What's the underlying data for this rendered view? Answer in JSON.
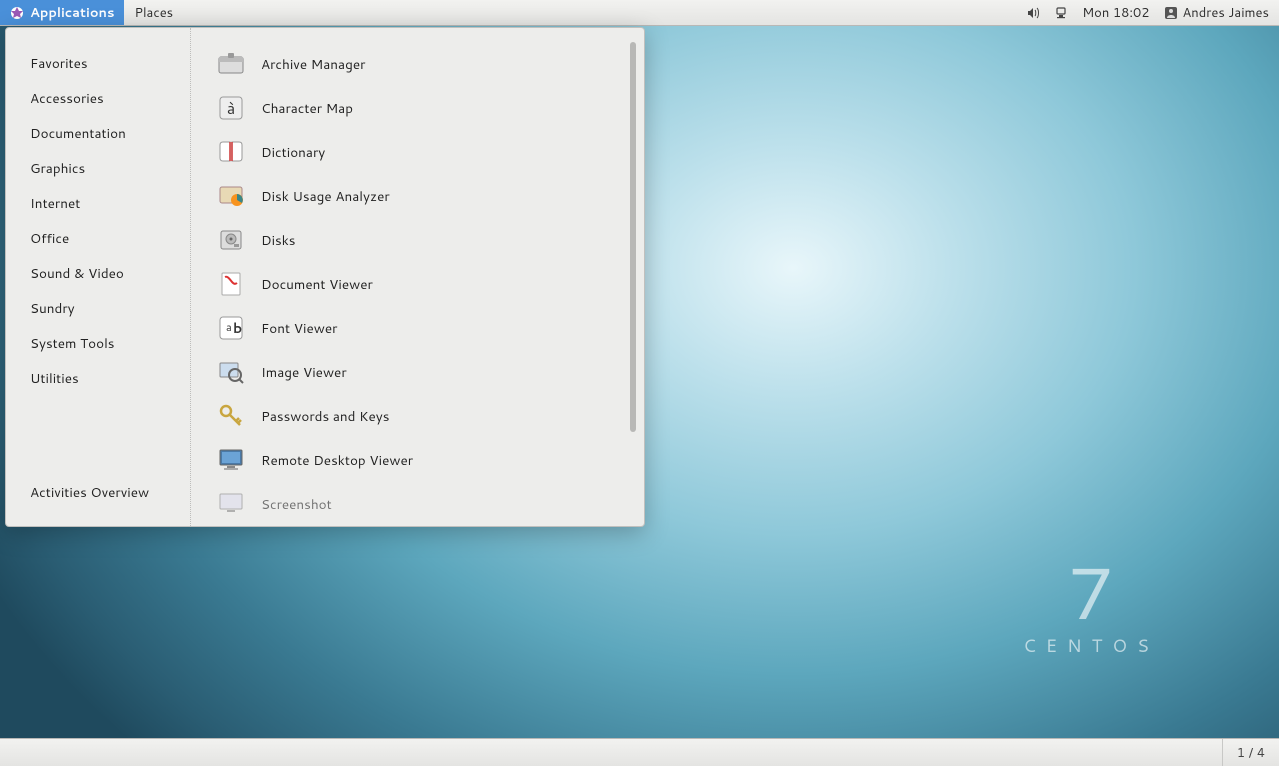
{
  "panel": {
    "applications": "Applications",
    "places": "Places",
    "datetime": "Mon 18:02",
    "username": "Andres Jaimes"
  },
  "menu": {
    "categories": [
      "Favorites",
      "Accessories",
      "Documentation",
      "Graphics",
      "Internet",
      "Office",
      "Sound & Video",
      "Sundry",
      "System Tools",
      "Utilities"
    ],
    "activities": "Activities Overview",
    "apps": [
      "Archive Manager",
      "Character Map",
      "Dictionary",
      "Disk Usage Analyzer",
      "Disks",
      "Document Viewer",
      "Font Viewer",
      "Image Viewer",
      "Passwords and Keys",
      "Remote Desktop Viewer",
      "Screenshot"
    ]
  },
  "wallpaper": {
    "distro": "CENTOS",
    "version": "7"
  },
  "workspace": "1 / 4"
}
